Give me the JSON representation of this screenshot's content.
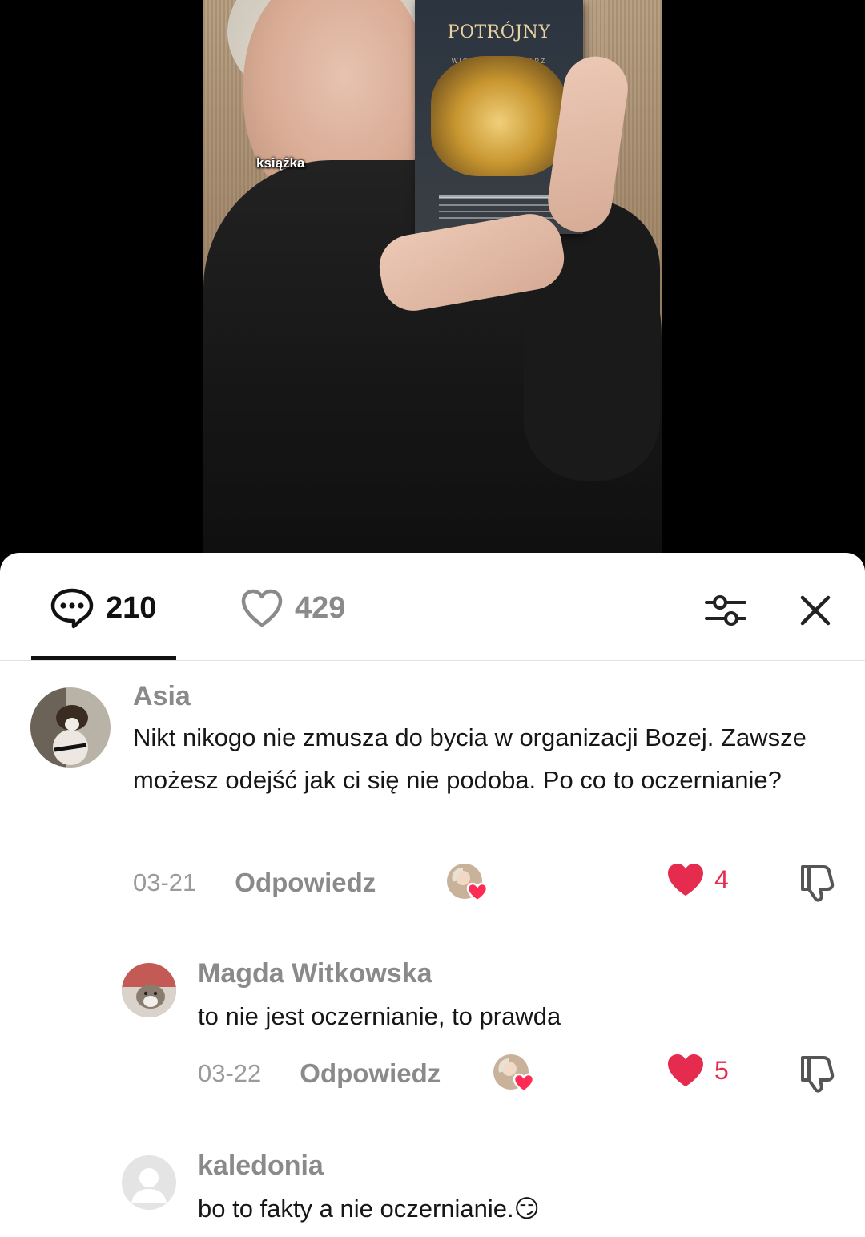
{
  "video": {
    "caption": "książka",
    "book": {
      "title": "POTRÓJNY",
      "author": "WIOLETA PRZYSTARZ"
    }
  },
  "panel": {
    "comments_count": "210",
    "likes_count": "429"
  },
  "comments": [
    {
      "username": "Asia",
      "text": "Nikt nikogo nie zmusza do bycia w organizacji Bozej. Zawsze możesz odejść jak ci się nie podoba. Po co to oczernianie?",
      "date": "03-21",
      "reply_label": "Odpowiedz",
      "likes": "4"
    },
    {
      "username": "Magda Witkowska",
      "text": "to nie jest oczernianie, to prawda",
      "date": "03-22",
      "reply_label": "Odpowiedz",
      "likes": "5"
    },
    {
      "username": "kaledonia",
      "text": "bo to fakty a nie oczernianie.😏"
    }
  ],
  "colors": {
    "like_red": "#e62c4e",
    "muted_gray": "#8a8a8a",
    "text_dark": "#161616"
  },
  "icons": [
    "comment-icon",
    "heart-icon",
    "filter-icon",
    "close-icon",
    "dislike-icon",
    "creator-liked-icon"
  ]
}
